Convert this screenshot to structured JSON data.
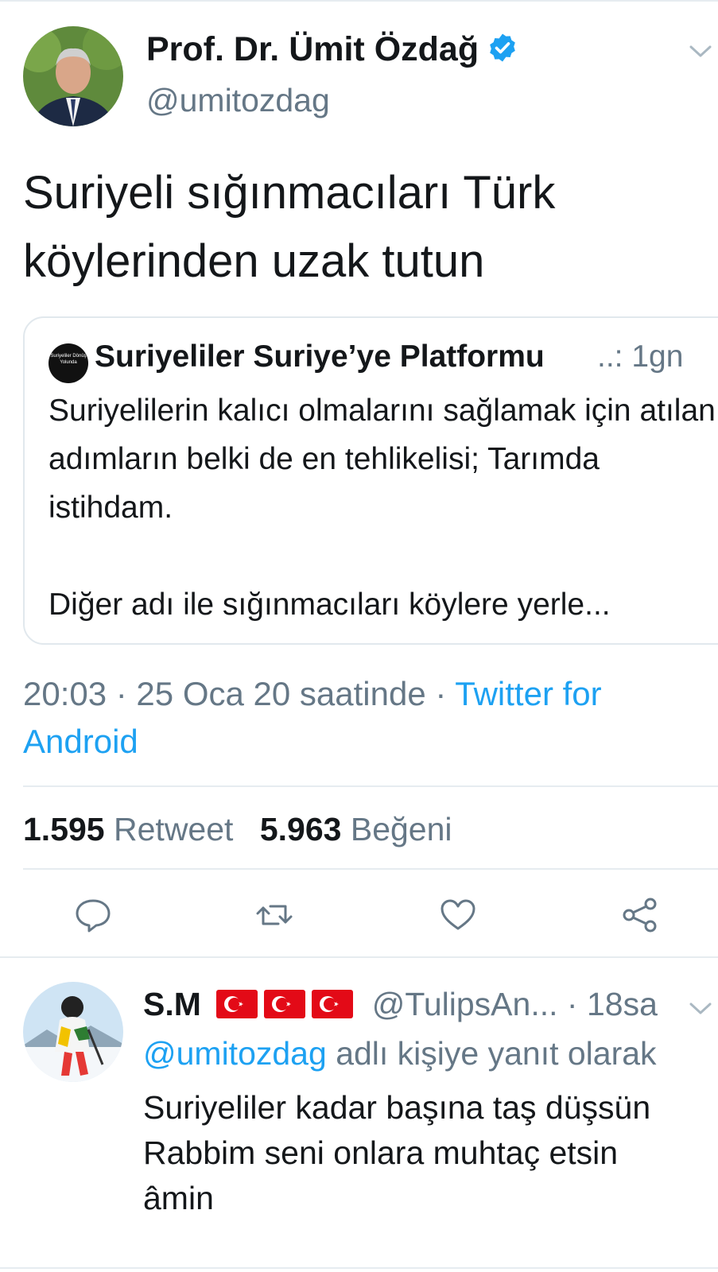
{
  "tweet": {
    "author": {
      "display_name": "Prof. Dr. Ümit Özdağ",
      "handle": "@umitozdag",
      "verified": true
    },
    "text": "Suriyeli sığınmacıları Türk köylerinden uzak tutun",
    "quoted": {
      "avatar_text": "Suriyeliler Dönüş Yolunda",
      "name": "Suriyeliler Suriye’ye Platformu",
      "meta": "..: 1gn",
      "text": "Suriyelilerin kalıcı olmalarını sağlamak için atılan adımların belki de en tehlikelisi; Tarımda istihdam.\n\nDiğer adı ile sığınmacıları köylere yerle..."
    },
    "timestamp": "20:03 · 25 Oca 20 saatinde · ",
    "source": "Twitter for Android",
    "stats": {
      "retweets": "1.595",
      "retweets_label": "Retweet",
      "likes": "5.963",
      "likes_label": "Beğeni"
    },
    "actions": [
      "reply-icon",
      "retweet-icon",
      "like-icon",
      "share-icon"
    ]
  },
  "reply": {
    "display_name": "S.M",
    "handle": "@TulipsAn...",
    "time": "· 18sa",
    "replying_mention": "@umitozdag",
    "replying_suffix": " adlı kişiye yanıt olarak",
    "text": "Suriyeliler kadar başına taş düşsün\nRabbim seni onlara muhtaç etsin\nâmin"
  },
  "colors": {
    "accent": "#1da1f2",
    "secondary_text": "#657786",
    "flag_red": "#e30a17"
  }
}
